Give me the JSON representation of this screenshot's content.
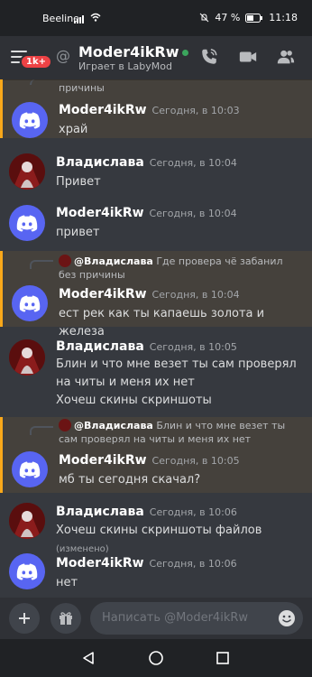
{
  "status_bar": {
    "carrier": "Beeline",
    "battery": "47 %",
    "time": "11:18"
  },
  "header": {
    "badge": "1k+",
    "at_symbol": "@",
    "username": "Moder4ikRw",
    "status": "Играет в LabyMod",
    "icons": [
      "menu-icon",
      "call-icon",
      "video-icon",
      "members-icon"
    ]
  },
  "colors": {
    "blurple": "#5865f2",
    "online": "#3ba55d",
    "highlight": "#faa81a",
    "badge": "#ed4245"
  },
  "messages": [
    {
      "reply_snippet": "причины",
      "author": "Moder4ikRw",
      "time": "Сегодня, в 10:03",
      "text": "храй",
      "avatar": "discord",
      "highlight": true
    },
    {
      "author": "Владислава",
      "time": "Сегодня, в 10:04",
      "text": "Привет",
      "avatar": "photo"
    },
    {
      "author": "Moder4ikRw",
      "time": "Сегодня, в 10:04",
      "text": "привет",
      "avatar": "discord"
    },
    {
      "reply_author": "@Владислава",
      "reply_text": "Где провера чё забанил без причины",
      "author": "Moder4ikRw",
      "time": "Сегодня, в 10:04",
      "text": "ест рек как ты капаешь  золота и железа",
      "avatar": "discord",
      "highlight": true
    },
    {
      "author": "Владислава",
      "time": "Сегодня, в 10:05",
      "text": "Блин и что мне везет ты сам проверял на читы и меня их нет",
      "text2": "Хочеш скины скриншоты",
      "avatar": "photo"
    },
    {
      "reply_author": "@Владислава",
      "reply_text": "Блин и что мне везет ты сам проверял на читы и меня их нет",
      "author": "Moder4ikRw",
      "time": "Сегодня, в 10:05",
      "text": "мб ты сегодня скачал?",
      "avatar": "discord",
      "highlight": true
    },
    {
      "author": "Владислава",
      "time": "Сегодня, в 10:06",
      "text": "Хочеш скины скриншоты файлов",
      "edited": "(изменено)",
      "avatar": "photo"
    },
    {
      "author": "Moder4ikRw",
      "time": "Сегодня, в 10:06",
      "text": "нет",
      "avatar": "discord"
    }
  ],
  "composer": {
    "placeholder": "Написать @Moder4ikRw"
  }
}
